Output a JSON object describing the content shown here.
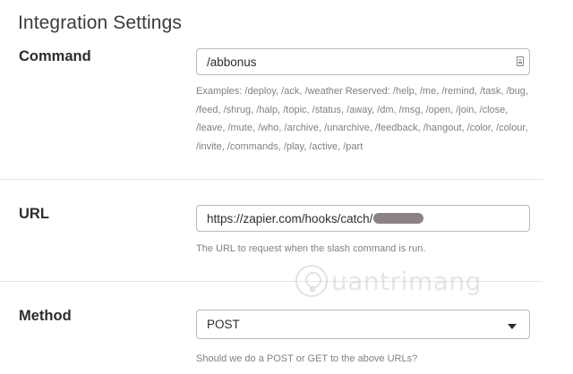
{
  "page": {
    "title": "Integration Settings"
  },
  "command": {
    "label": "Command",
    "value": "/abbonus",
    "hint": "Examples: /deploy, /ack, /weather Reserved: /help, /me, /remind, /task, /bug, /feed, /shrug, /halp, /topic, /status, /away, /dm, /msg, /open, /join, /close, /leave, /mute, /who, /archive, /unarchive, /feedback, /hangout, /color, /colour, /invite, /commands, /play, /active, /part",
    "icon": "contact-card-icon"
  },
  "url": {
    "label": "URL",
    "value": "https://zapier.com/hooks/catch/",
    "hint": "The URL to request when the slash command is run."
  },
  "method": {
    "label": "Method",
    "value": "POST",
    "hint": "Should we do a POST or GET to the above URLs?",
    "icon": "caret-down-icon"
  },
  "watermark": {
    "text": "uantrimang"
  },
  "colors": {
    "border": "#b9b9bb",
    "hint_text": "#7f8084",
    "divider": "#e6e6e8",
    "redaction": "#8c8283"
  }
}
